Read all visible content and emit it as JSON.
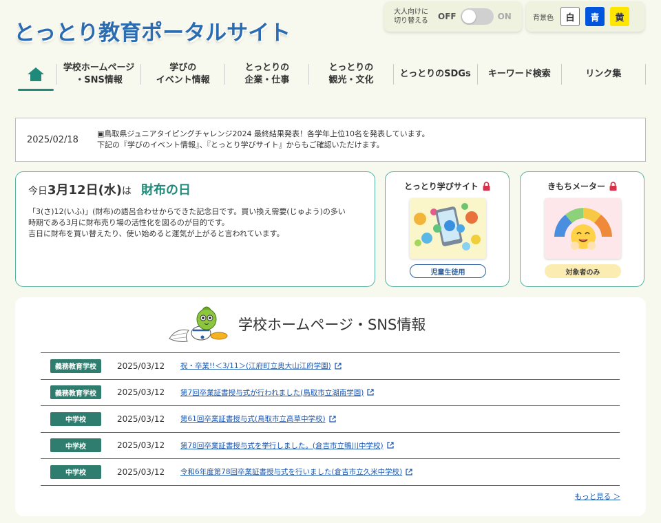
{
  "site": {
    "logo_text": "とっとり教育ポータルサイト"
  },
  "toggle": {
    "label_line1": "大人向けに",
    "label_line2": "切り替える",
    "off_label": "OFF",
    "on_label": "ON",
    "state": "off"
  },
  "background": {
    "label": "背景色",
    "options": [
      "白",
      "青",
      "黄"
    ],
    "colors": {
      "white": "#ffffff",
      "blue": "#0055dd",
      "yellow": "#ffe600"
    }
  },
  "nav": {
    "home_icon": "home-icon",
    "items": [
      "学校ホームページ\n・SNS情報",
      "学びの\nイベント情報",
      "とっとりの\n企業・仕事",
      "とっとりの\n観光・文化",
      "とっとりのSDGs",
      "キーワード検索",
      "リンク集"
    ]
  },
  "news": {
    "date": "2025/02/18",
    "line1": "▣鳥取県ジュニアタイピングチャレンジ2024 最終結果発表！各学年上位10名を発表しています。",
    "line2": "下記の『学びのイベント情報』、『とっとり学びサイト』からもご確認いただけます。"
  },
  "today": {
    "prefix": "今日",
    "date": "3月12日(水)",
    "wa": "は",
    "day_name": "財布の日",
    "body": "「3(さ)12(いふ)」(財布)の語呂合わせからできた記念日です。買い換え需要(じゅよう)の多い\n時期である3月に財布売り場の活性化を図るのが目的です。\n吉日に財布を買い替えたり、使い始めると運気が上がると言われています。"
  },
  "cards": [
    {
      "title": "とっとり学びサイト",
      "button": "児童生徒用",
      "icon": "lock-icon"
    },
    {
      "title": "きもちメーター",
      "button": "対象者のみ",
      "icon": "lock-icon"
    }
  ],
  "sns": {
    "title": "学校ホームページ・SNS情報",
    "rows": [
      {
        "badge": "義務教育学校",
        "date": "2025/03/12",
        "link": "祝・卒業!!＜3/11＞(江府町立奥大山江府学園)"
      },
      {
        "badge": "義務教育学校",
        "date": "2025/03/12",
        "link": "第7回卒業証書授与式が行われました(鳥取市立湖南学園)"
      },
      {
        "badge": "中学校",
        "date": "2025/03/12",
        "link": "第61回卒業証書授与式(鳥取市立高草中学校)"
      },
      {
        "badge": "中学校",
        "date": "2025/03/12",
        "link": "第78回卒業証書授与式を挙行しました。(倉吉市立鴨川中学校)"
      },
      {
        "badge": "中学校",
        "date": "2025/03/12",
        "link": "令和6年度第78回卒業証書授与式を行いました(倉吉市立久米中学校)"
      }
    ],
    "more": "もっと見る ＞"
  }
}
